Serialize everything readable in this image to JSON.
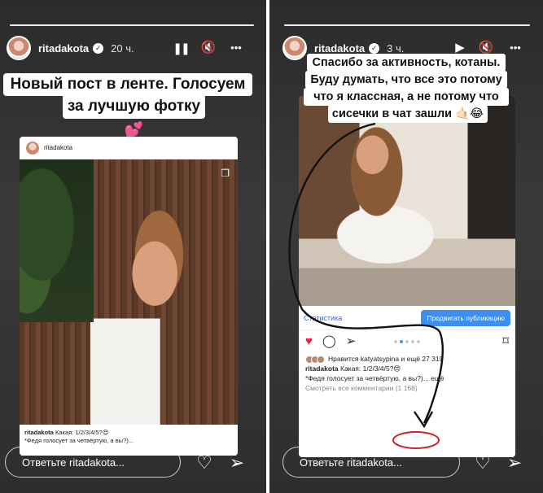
{
  "left_story": {
    "username": "ritadakota",
    "time": "20 ч.",
    "caption_line1": "Новый пост в ленте. Голосуем",
    "caption_line2": "за лучшую фотку💕",
    "post": {
      "username": "ritadakota",
      "caption_user": "ritadakota",
      "caption_text": " Какая: 1/2/3/4/5?😍",
      "comment": "*Федя голосует за четвёртую, а вы?)..."
    },
    "reply_placeholder": "Ответьте ritadakota..."
  },
  "right_story": {
    "username": "ritadakota",
    "time": "3 ч.",
    "caption_line1": "Спасибо за активность, котаны.",
    "caption_line2": "Буду думать, что все это потому",
    "caption_line3": "что я классная, а не потому что",
    "caption_line4": "сисечки в чат зашли 🤙🏻😂",
    "post": {
      "stats_label": "Статистика",
      "promote_label": "Продвигать публикацию",
      "liked_by": "Нравится katyatsypina и ещё 27 319",
      "caption_user": "ritadakota",
      "caption_text": " Какая: 1/2/3/4/5?😍",
      "comment": "*Федя голосует за четвёртую, а вы?)... ещё",
      "view_comments": "Смотреть все комментарии",
      "comments_count": "(1 168)",
      "annotation_color": "#d61f1f"
    },
    "reply_placeholder": "Ответьте ritadakota..."
  },
  "icons": {
    "verified": "✓",
    "pause": "❚❚",
    "mute": "🔇",
    "more": "•••",
    "play": "▶",
    "heart_outline": "♡",
    "heart_filled": "♥",
    "send": "➢",
    "comment": "◯",
    "bookmark": "⌑",
    "multi": "❐"
  }
}
